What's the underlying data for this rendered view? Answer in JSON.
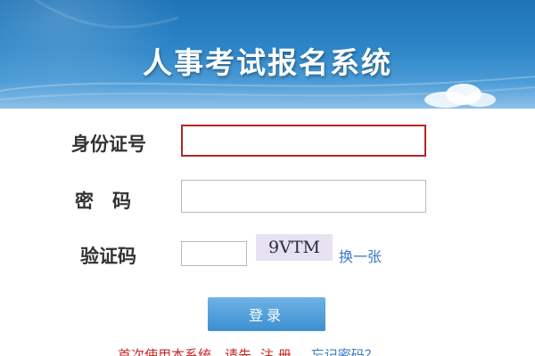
{
  "header": {
    "title": "人事考试报名系统"
  },
  "form": {
    "id_label": "身份证号",
    "id_value": "",
    "password_label": "密　码",
    "password_value": "",
    "captcha_label": "验证码",
    "captcha_value": "",
    "captcha_text": "9VTM",
    "refresh_label": "换一张"
  },
  "actions": {
    "login_label": "登录"
  },
  "footer": {
    "first_use_text": "首次使用本系统，请先",
    "register_label": "注 册",
    "forgot_label": "忘记密码？"
  },
  "colors": {
    "banner": "#2d86c8",
    "accent_red": "#c62828",
    "link_blue": "#3b78c2"
  }
}
